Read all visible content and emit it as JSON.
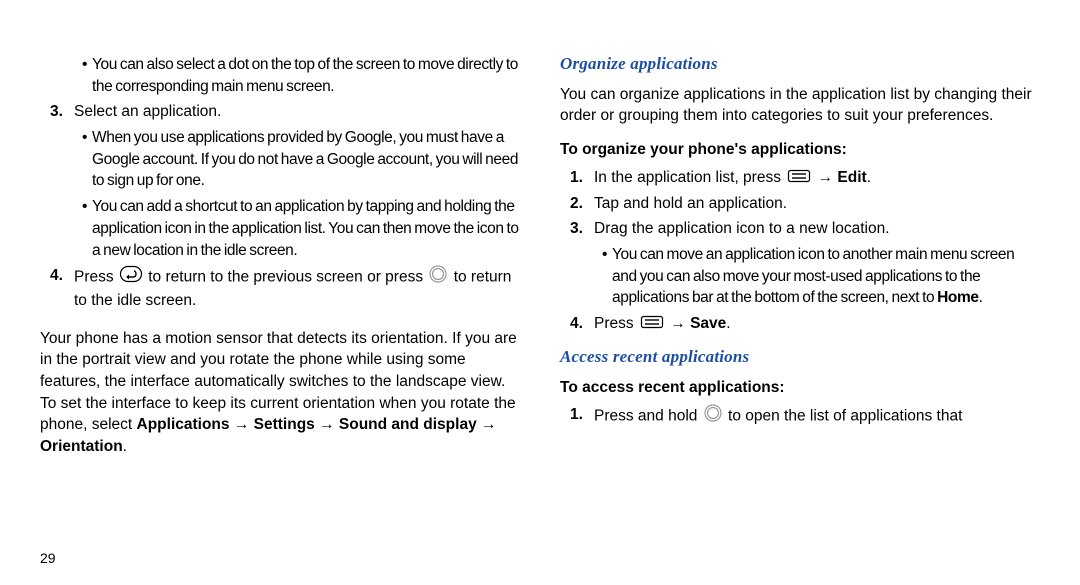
{
  "left": {
    "bullets_top": [
      "You can also select a dot on the top of the screen to move directly to the corresponding main menu screen."
    ],
    "step3_num": "3.",
    "step3": "Select an application.",
    "bullets_mid": [
      "When you use applications provided by Google, you must have a Google account. If you do not have a Google account, you will need to sign up for one.",
      "You can add a shortcut to an application by tapping and holding the application icon in the application list. You can then move the icon to a new location in the idle screen."
    ],
    "step4_num": "4.",
    "step4_a": "Press ",
    "step4_b": " to return to the previous screen or press ",
    "step4_c": " to return to the idle screen.",
    "para_a": "Your phone has a motion sensor that detects its orientation. If you are in the portrait view and you rotate the phone while using some features, the interface automatically switches to the landscape view. To set the interface to keep its current orientation when you rotate the phone, select ",
    "para_b": "Applications → Settings → Sound and display → Orientation",
    "para_c": ".",
    "page_num": "29"
  },
  "right": {
    "title1": "Organize applications",
    "intro": "You can organize applications in the application list by changing their order or grouping them into categories to suit your preferences.",
    "sub1": "To organize your phone's applications:",
    "s1_num": "1.",
    "s1_a": "In the application list, press ",
    "s1_b": " → ",
    "s1_c": "Edit",
    "s1_d": ".",
    "s2_num": "2.",
    "s2": "Tap and hold an application.",
    "s3_num": "3.",
    "s3": "Drag the application icon to a new location.",
    "bullet_a": "You can move an application icon to another main menu screen and you can also move your most-used applications to the applications bar at the bottom of the screen, next to ",
    "bullet_b": "Home",
    "bullet_c": ".",
    "s4_num": "4.",
    "s4_a": "Press ",
    "s4_b": " → ",
    "s4_c": "Save",
    "s4_d": ".",
    "title2": "Access recent applications",
    "sub2": "To access recent applications:",
    "r1_num": "1.",
    "r1_a": "Press and hold ",
    "r1_b": " to open the list of applications that"
  }
}
